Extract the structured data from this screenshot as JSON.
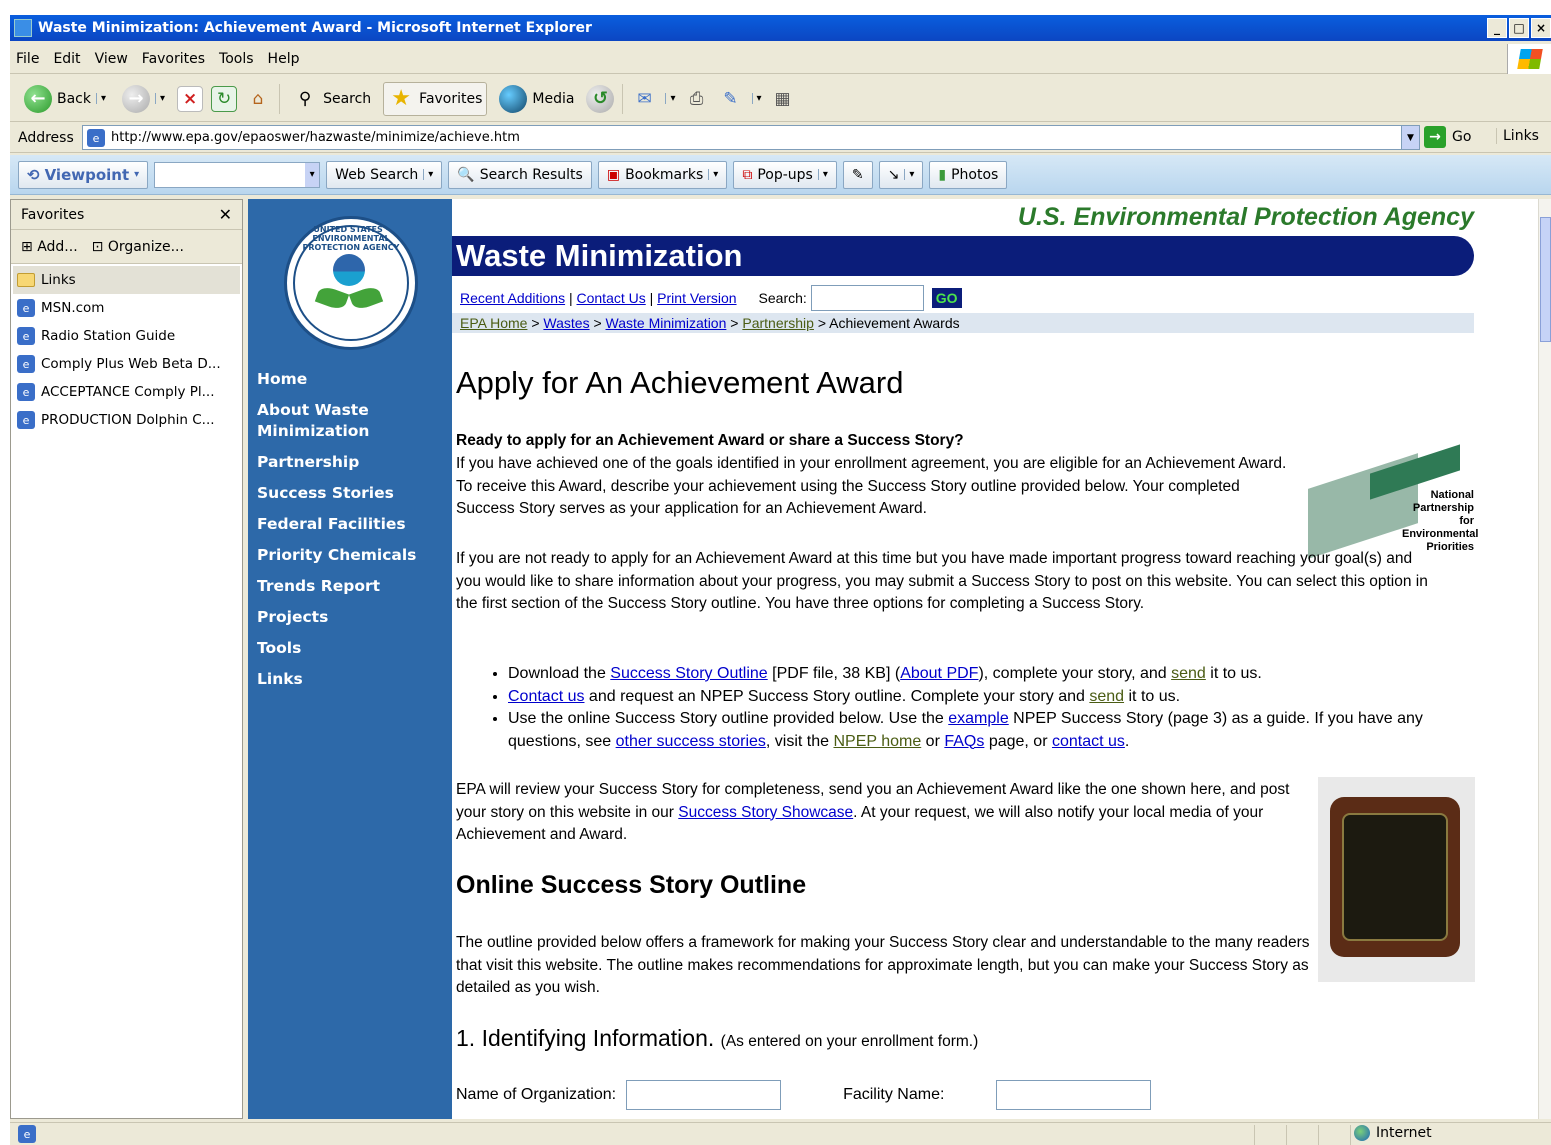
{
  "window": {
    "title": "Waste Minimization: Achievement Award - Microsoft Internet Explorer"
  },
  "menu": [
    "File",
    "Edit",
    "View",
    "Favorites",
    "Tools",
    "Help"
  ],
  "toolbar": {
    "back": "Back",
    "search": "Search",
    "favorites": "Favorites",
    "media": "Media"
  },
  "address": {
    "label": "Address",
    "url": "http://www.epa.gov/epaoswer/hazwaste/minimize/achieve.htm",
    "go": "Go",
    "links": "Links"
  },
  "searchbar": {
    "viewpoint": "Viewpoint",
    "web_search": "Web Search",
    "search_results": "Search Results",
    "bookmarks": "Bookmarks",
    "popups": "Pop-ups",
    "photos": "Photos"
  },
  "favorites": {
    "title": "Favorites",
    "add": "Add...",
    "organize": "Organize...",
    "items": [
      "Links",
      "MSN.com",
      "Radio Station Guide",
      "Comply Plus Web Beta D...",
      "ACCEPTANCE Comply Pl...",
      "PRODUCTION Dolphin C..."
    ]
  },
  "logo": {
    "text": "UNITED STATES · ENVIRONMENTAL PROTECTION AGENCY"
  },
  "nav": [
    "Home",
    "About Waste Minimization",
    "Partnership",
    "Success Stories",
    "Federal Facilities",
    "Priority Chemicals",
    "Trends Report",
    "Projects",
    "Tools",
    "Links"
  ],
  "page": {
    "agency": "U.S. Environmental Protection Agency",
    "banner": "Waste Minimization",
    "util": {
      "recent": "Recent Additions",
      "contact": "Contact Us",
      "print": "Print Version",
      "search_label": "Search:",
      "go": "GO"
    },
    "breadcrumb": {
      "home": "EPA Home",
      "wastes": "Wastes",
      "wm": "Waste Minimization",
      "partnership": "Partnership",
      "current": "Achievement Awards"
    },
    "h1": "Apply for An Achievement Award",
    "lead": "Ready to apply for an Achievement Award or share a Success Story?",
    "p1": "If you have achieved one of the goals identified in your enrollment agreement, you are eligible for an Achievement Award. To receive this Award, describe your achievement using the Success Story outline provided below. Your completed Success Story serves as your application for an Achievement Award.",
    "npep": "National Partnership for Environmental Priorities",
    "p2": "If you are not ready to apply for an Achievement Award at this time but you have made important progress toward reaching your goal(s) and you would like to share information about your progress, you may submit a Success Story to post on this website. You can select this option in the first section of the Success Story outline. You have three options for completing a Success Story.",
    "b1": {
      "t1": "Download the ",
      "l1": "Success Story Outline",
      "t2": " [PDF file, 38 KB] (",
      "l2": "About PDF",
      "t3": "), complete your story, and ",
      "l3": "send",
      "t4": " it to us."
    },
    "b2": {
      "l1": "Contact us",
      "t1": " and request an NPEP Success Story outline. Complete your story and ",
      "l2": "send",
      "t2": " it to us."
    },
    "b3": {
      "t1": "Use the online Success Story outline provided below. Use the ",
      "l1": "example",
      "t2": " NPEP Success Story (page 3) as a guide. If you have any questions, see ",
      "l2": "other success stories",
      "t3": ", visit the ",
      "l3": "NPEP home",
      "t4": " or ",
      "l4": "FAQs",
      "t5": " page, or ",
      "l5": "contact us",
      "t6": "."
    },
    "p3": {
      "t1": "EPA will review your Success Story for completeness, send you an Achievement Award like the one shown here, and post your story on this website in our ",
      "l1": "Success Story Showcase",
      "t2": ". At your request, we will also notify your local media of your Achievement and Award."
    },
    "h2": "Online Success Story Outline",
    "p4": "The outline provided below offers a framework for making your Success Story clear and understandable to the many readers that visit this website. The outline makes recommendations for approximate length, but you can make your Success Story as detailed as you wish.",
    "h3": "1. Identifying Information.",
    "h3_note": "(As entered on your enrollment form.)",
    "org_label": "Name of Organization:",
    "facility_label": "Facility Name:"
  },
  "status": {
    "zone": "Internet"
  }
}
